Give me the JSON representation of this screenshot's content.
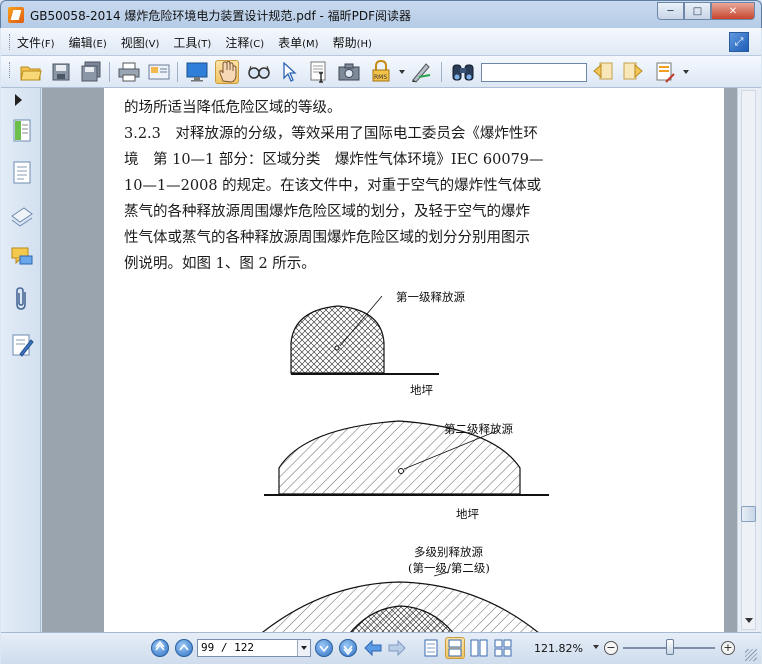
{
  "window": {
    "title": "GB50058-2014 爆炸危险环境电力装置设计规范.pdf - 福昕PDF阅读器",
    "minimize": "─",
    "restore": "□",
    "close": "✕"
  },
  "menu": {
    "items": [
      {
        "label": "文件",
        "accel": "(F)"
      },
      {
        "label": "编辑",
        "accel": "(E)"
      },
      {
        "label": "视图",
        "accel": "(V)"
      },
      {
        "label": "工具",
        "accel": "(T)"
      },
      {
        "label": "注释",
        "accel": "(C)"
      },
      {
        "label": "表单",
        "accel": "(M)"
      },
      {
        "label": "帮助",
        "accel": "(H)"
      }
    ]
  },
  "toolbar": {
    "search_value": "",
    "icons": [
      "open-folder-icon",
      "save-icon",
      "save-all-icon",
      "print-icon",
      "email-icon",
      "fullscreen-monitor-icon",
      "hand-tool-icon",
      "zoom-glasses-icon",
      "select-arrow-icon",
      "select-text-icon",
      "snapshot-camera-icon",
      "rms-lock-icon",
      "sign-pen-icon",
      "binoculars-icon",
      "find-previous-icon",
      "find-next-icon",
      "highlight-icon"
    ],
    "rms_label": "RMS"
  },
  "document": {
    "lines": [
      "的场所适当降低危险区域的等级。",
      "3.2.3　对释放源的分级，等效采用了国际电工委员会《爆炸性环",
      "境　第 10—1 部分：区域分类　爆炸性气体环境》IEC 60079—",
      "10—1—2008 的规定。在该文件中，对重于空气的爆炸性气体或",
      "蒸气的各种释放源周围爆炸危险区域的划分，及轻于空气的爆炸",
      "性气体或蒸气的各种释放源周围爆炸危险区域的划分分别用图示",
      "例说明。如图 1、图 2 所示。"
    ],
    "figure": {
      "label_primary": "第一级释放源",
      "label_ground_1": "地坪",
      "label_secondary": "第二级释放源",
      "label_ground_2": "地坪",
      "label_multi_1": "多级别释放源",
      "label_multi_2": "(第一级/第二级)"
    }
  },
  "statusbar": {
    "page_value": "99 / 122",
    "zoom": "121.82%",
    "zoom_out": "−",
    "zoom_in": "+",
    "zoom_level_percent": 121.82
  }
}
